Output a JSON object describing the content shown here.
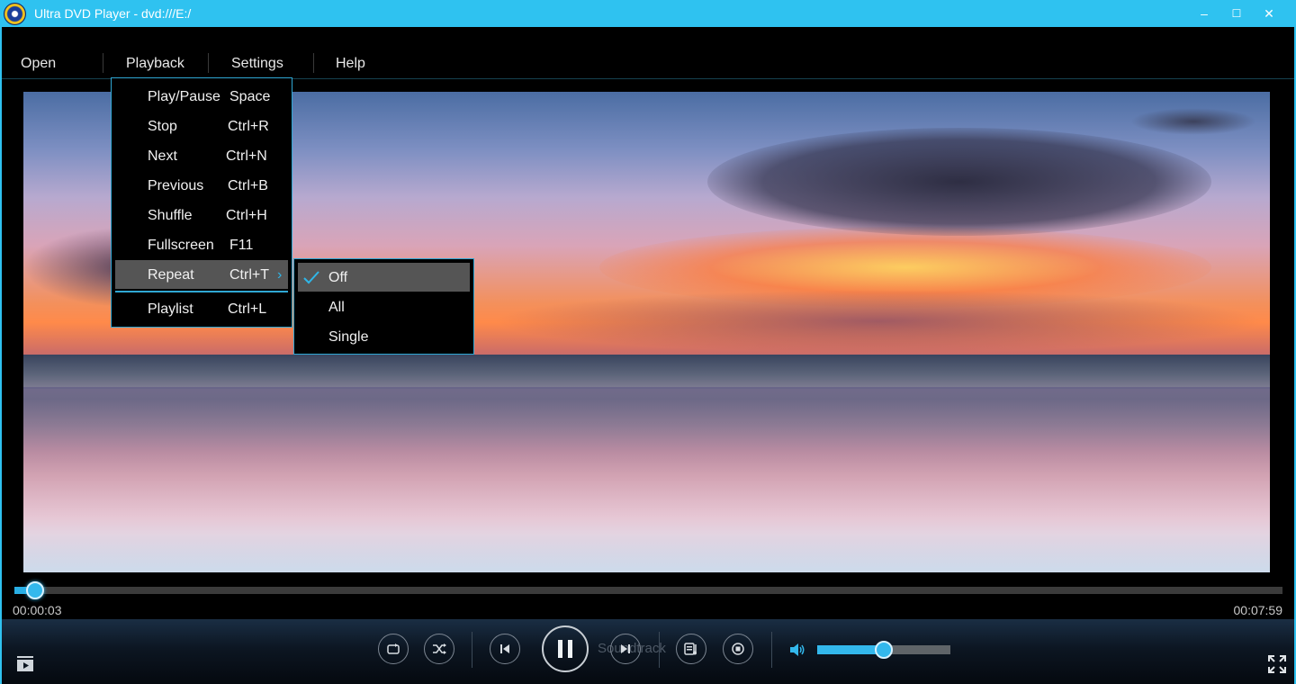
{
  "window": {
    "title": "Ultra DVD Player - dvd:///E:/",
    "minimize_glyph": "‒",
    "maximize_glyph": "☐",
    "close_glyph": "✕",
    "accent_color": "#2fc2f0"
  },
  "menubar": {
    "items": [
      "Open",
      "Playback",
      "Settings",
      "Help"
    ]
  },
  "playback_menu": {
    "items": [
      {
        "label": "Play/Pause",
        "shortcut": "Space"
      },
      {
        "label": "Stop",
        "shortcut": "Ctrl+R"
      },
      {
        "label": "Next",
        "shortcut": "Ctrl+N"
      },
      {
        "label": "Previous",
        "shortcut": "Ctrl+B"
      },
      {
        "label": "Shuffle",
        "shortcut": "Ctrl+H"
      },
      {
        "label": "Fullscreen",
        "shortcut": "F11"
      },
      {
        "label": "Repeat",
        "shortcut": "Ctrl+T",
        "highlighted": true,
        "has_submenu": true
      },
      {
        "label": "Playlist",
        "shortcut": "Ctrl+L"
      }
    ]
  },
  "repeat_submenu": {
    "items": [
      {
        "label": "Off",
        "checked": true,
        "highlighted": true
      },
      {
        "label": "All",
        "checked": false
      },
      {
        "label": "Single",
        "checked": false
      }
    ]
  },
  "player": {
    "current_time": "00:00:03",
    "total_time": "00:07:59",
    "progress_fraction": 0.015,
    "volume_fraction": 0.5,
    "ghost_label": "Soundtrack",
    "icons": [
      "repeat-icon",
      "shuffle-icon",
      "previous-icon",
      "pause-icon",
      "next-icon",
      "playlist-icon",
      "stop-icon",
      "volume-icon",
      "fullscreen-icon",
      "library-icon"
    ]
  }
}
